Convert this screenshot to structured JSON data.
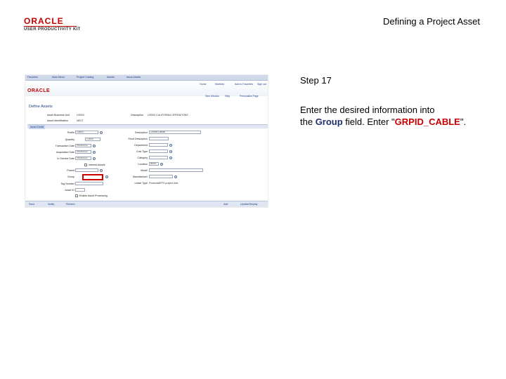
{
  "header": {
    "logo_oracle": "ORACLE",
    "logo_sub": "USER PRODUCTIVITY KIT",
    "title": "Defining a Project Asset"
  },
  "screenshot": {
    "topnav": [
      "Favorites",
      "Main Menu",
      "Project Costing",
      "Assets",
      "Issue Assets"
    ],
    "brand": "ORACLE",
    "right_links": [
      "Home",
      "Worklist",
      "Add to Favorites",
      "Sign out"
    ],
    "sub_links": [
      "New Window",
      "Help",
      "Personalize Page"
    ],
    "form_title": "Define Assets",
    "business_unit_label": "Asset Business Unit",
    "business_unit_value": "US003",
    "description_label": "Description",
    "description_value": "US003 CALIFORNIA OPERATIONS",
    "asset_identification_label": "Asset Identification",
    "asset_identification_value": "NEXT",
    "tab_label": "Asset Detail",
    "left_labels": [
      "Profile",
      "Quantity",
      "Transaction Date",
      "Acquisition Date",
      "In Service Date",
      "",
      "Parent",
      "Group",
      "Tag Number",
      "Asset ID"
    ],
    "left_values": [
      "CABLE",
      "1.0000",
      "09/28/2012",
      "09/28/2012",
      "09/28/2012",
      "",
      "",
      "",
      "",
      ""
    ],
    "right_labels": [
      "Description",
      "Short Description",
      "Department",
      "Cost Type",
      "Category",
      "Location",
      "Model",
      "Manufacturer",
      "Lease Type"
    ],
    "right_values": [
      "Control Cables",
      "",
      "",
      "",
      "",
      "BASE",
      "",
      "",
      "Financial/EFS project Add"
    ],
    "checkbox_labels": [
      "Interest Assets",
      "Enable Asset Processing"
    ],
    "bottom_left": [
      "Save",
      "Notify",
      "Refresh"
    ],
    "bottom_right": [
      "Add",
      "Update/Display"
    ]
  },
  "instruction": {
    "step": "Step 17",
    "line1": "Enter the desired information into",
    "pre_field": "the ",
    "field_name": "Group",
    "mid": " field. Enter \"",
    "entry_value": "GRPID_CABLE",
    "end": "\"."
  }
}
